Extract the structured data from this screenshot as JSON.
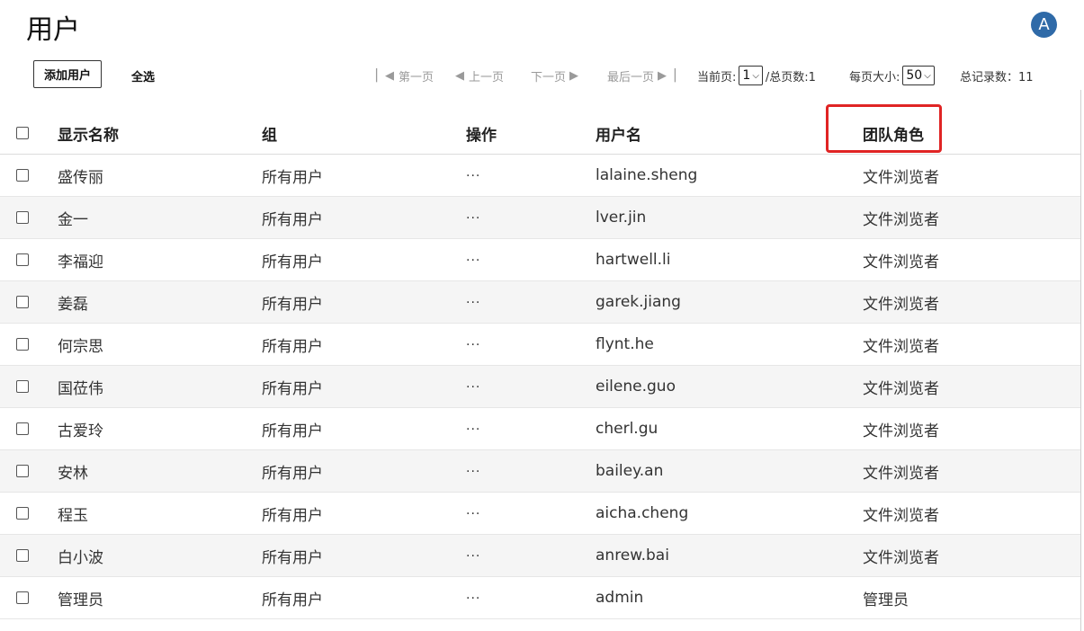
{
  "header": {
    "title": "用户",
    "avatar_letter": "A"
  },
  "toolbar": {
    "add_user": "添加用户",
    "select_all": "全选"
  },
  "pager": {
    "first": "第一页",
    "prev": "上一页",
    "next": "下一页",
    "last": "最后一页",
    "current_label": "当前页:",
    "current_page": "1",
    "total_pages_label": "/总页数:1",
    "page_size_label": "每页大小:",
    "page_size": "50",
    "total_records_label": "总记录数：11"
  },
  "table": {
    "headers": [
      "显示名称",
      "组",
      "操作",
      "用户名",
      "团队角色"
    ],
    "rows": [
      {
        "name": "盛传丽",
        "group": "所有用户",
        "op": "···",
        "username": "lalaine.sheng",
        "role": "文件浏览者"
      },
      {
        "name": "金一",
        "group": "所有用户",
        "op": "···",
        "username": "lver.jin",
        "role": "文件浏览者"
      },
      {
        "name": "李福迎",
        "group": "所有用户",
        "op": "···",
        "username": "hartwell.li",
        "role": "文件浏览者"
      },
      {
        "name": "姜磊",
        "group": "所有用户",
        "op": "···",
        "username": "garek.jiang",
        "role": "文件浏览者"
      },
      {
        "name": "何宗思",
        "group": "所有用户",
        "op": "···",
        "username": "flynt.he",
        "role": "文件浏览者"
      },
      {
        "name": "国莅伟",
        "group": "所有用户",
        "op": "···",
        "username": "eilene.guo",
        "role": "文件浏览者"
      },
      {
        "name": "古爱玲",
        "group": "所有用户",
        "op": "···",
        "username": "cherl.gu",
        "role": "文件浏览者"
      },
      {
        "name": "安林",
        "group": "所有用户",
        "op": "···",
        "username": "bailey.an",
        "role": "文件浏览者"
      },
      {
        "name": "程玉",
        "group": "所有用户",
        "op": "···",
        "username": "aicha.cheng",
        "role": "文件浏览者"
      },
      {
        "name": "白小波",
        "group": "所有用户",
        "op": "···",
        "username": "anrew.bai",
        "role": "文件浏览者"
      },
      {
        "name": "管理员",
        "group": "所有用户",
        "op": "···",
        "username": "admin",
        "role": "管理员"
      }
    ]
  },
  "colors": {
    "avatar": "#2f6aa8",
    "highlight": "#e02424",
    "row_alt": "#f5f5f5"
  }
}
